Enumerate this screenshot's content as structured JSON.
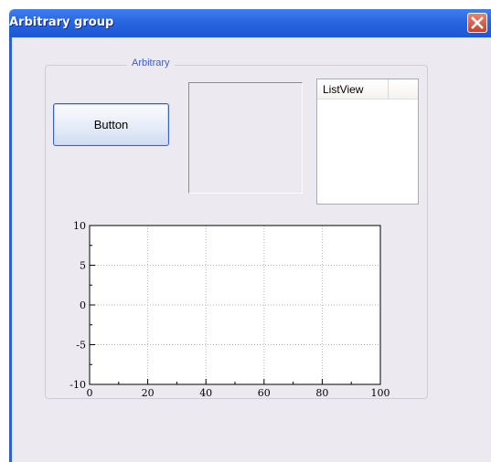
{
  "window": {
    "title": "Arbitrary group"
  },
  "group": {
    "label": "Arbitrary"
  },
  "button": {
    "label": "Button"
  },
  "listview": {
    "columns": [
      "ListView"
    ]
  },
  "chart_data": {
    "type": "line",
    "xlim": [
      0,
      100
    ],
    "ylim": [
      -10,
      10
    ],
    "x_ticks": [
      0,
      20,
      40,
      60,
      80,
      100
    ],
    "y_ticks": [
      -10,
      -5,
      0,
      5,
      10
    ],
    "grid": true,
    "series": []
  },
  "colors": {
    "titlebar": "#2a66e0",
    "close": "#c9412a",
    "group_label": "#3b5fc8"
  }
}
